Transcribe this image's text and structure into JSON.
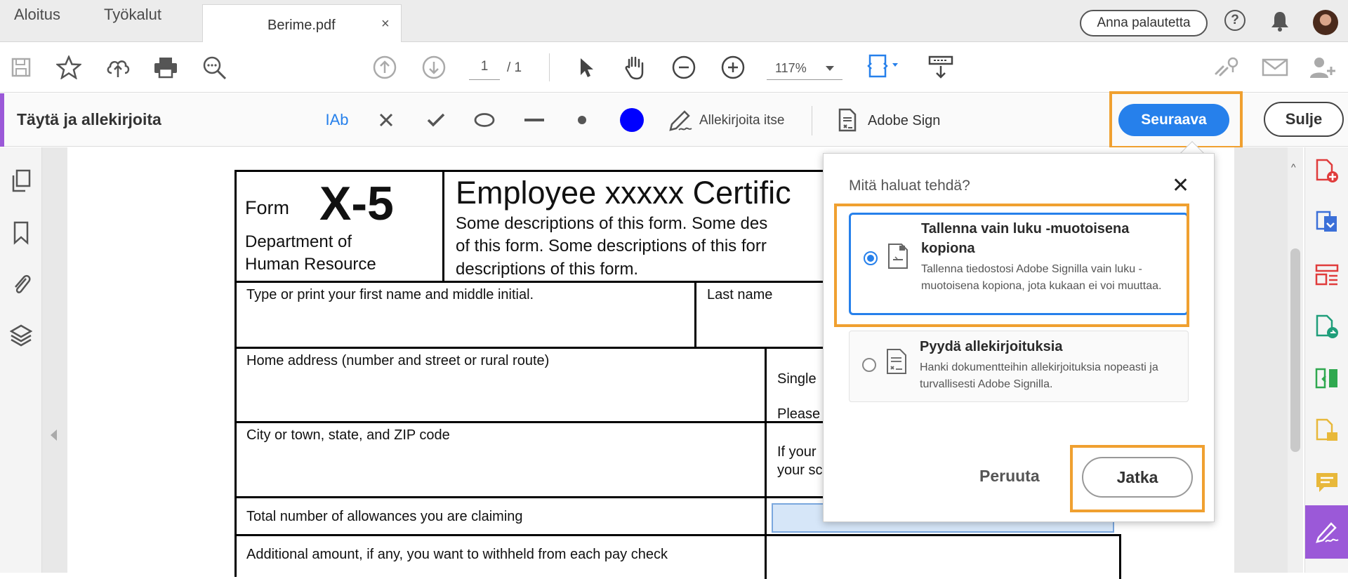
{
  "tabs": {
    "home": "Aloitus",
    "tools": "Työkalut",
    "document": "Berime.pdf",
    "close_glyph": "×"
  },
  "header": {
    "feedback_label": "Anna palautetta",
    "help_glyph": "?"
  },
  "toolbar": {
    "page_current": "1",
    "page_total": "/ 1",
    "zoom_value": "117%"
  },
  "fill_sign": {
    "title": "Täytä ja allekirjoita",
    "text_tool": "IAb",
    "sign_yourself": "Allekirjoita itse",
    "adobe_sign": "Adobe Sign",
    "next_button": "Seuraava",
    "close_button": "Sulje",
    "color_selected": "#0000ff"
  },
  "form": {
    "form_word": "Form",
    "form_number": "X-5",
    "department": "Department of",
    "department_line2": "Human Resource",
    "heading": "Employee xxxxx Certific",
    "desc_line1": "Some descriptions of this form. Some des",
    "desc_line2": "of this form. Some descriptions of this forr",
    "desc_line3": "descriptions of this form.",
    "first_name_label": "Type or print your first name and middle initial.",
    "last_name_label": "Last name",
    "home_address_label": "Home address (number and street or rural route)",
    "single_label": "Single",
    "please_label": "Please",
    "city_label": "City or town, state, and ZIP code",
    "if_your_label": "If your",
    "your_sc_label": "your sc",
    "allowances_label": "Total number of allowances you are claiming",
    "additional_label": "Additional amount, if any, you want to withheld from each pay check"
  },
  "popup": {
    "title": "Mitä haluat tehdä?",
    "close_glyph": "✕",
    "option1_title": "Tallenna vain luku -muotoisena kopiona",
    "option1_desc": "Tallenna tiedostosi Adobe Signilla vain luku -muotoisena kopiona, jota kukaan ei voi muuttaa.",
    "option1_selected": true,
    "option2_title": "Pyydä allekirjoituksia",
    "option2_desc": "Hanki dokumentteihin allekirjoituksia nopeasti ja turvallisesti Adobe Signilla.",
    "cancel_label": "Peruuta",
    "continue_label": "Jatka"
  },
  "colors": {
    "accent_blue": "#2680eb",
    "highlight_orange": "#f0a030",
    "fill_sign_purple": "#9b59d8"
  },
  "icons": {
    "toolbar": [
      "save-icon",
      "bookmark-star-icon",
      "cloud-upload-icon",
      "print-icon",
      "zoom-search-icon",
      "page-up-icon",
      "page-down-icon",
      "select-pointer-icon",
      "hand-icon",
      "zoom-out-icon",
      "zoom-in-icon",
      "fit-page-icon",
      "scroll-mode-icon",
      "share-link-icon",
      "email-icon",
      "add-user-icon"
    ],
    "left_sidebar": [
      "pages-icon",
      "bookmark-icon",
      "attachment-icon",
      "layers-icon"
    ],
    "right_sidebar": [
      "create-pdf-icon",
      "export-pdf-icon",
      "organize-pages-icon",
      "share-pdf-icon",
      "compare-icon",
      "edit-pdf-icon",
      "comment-icon",
      "fill-sign-icon"
    ]
  }
}
